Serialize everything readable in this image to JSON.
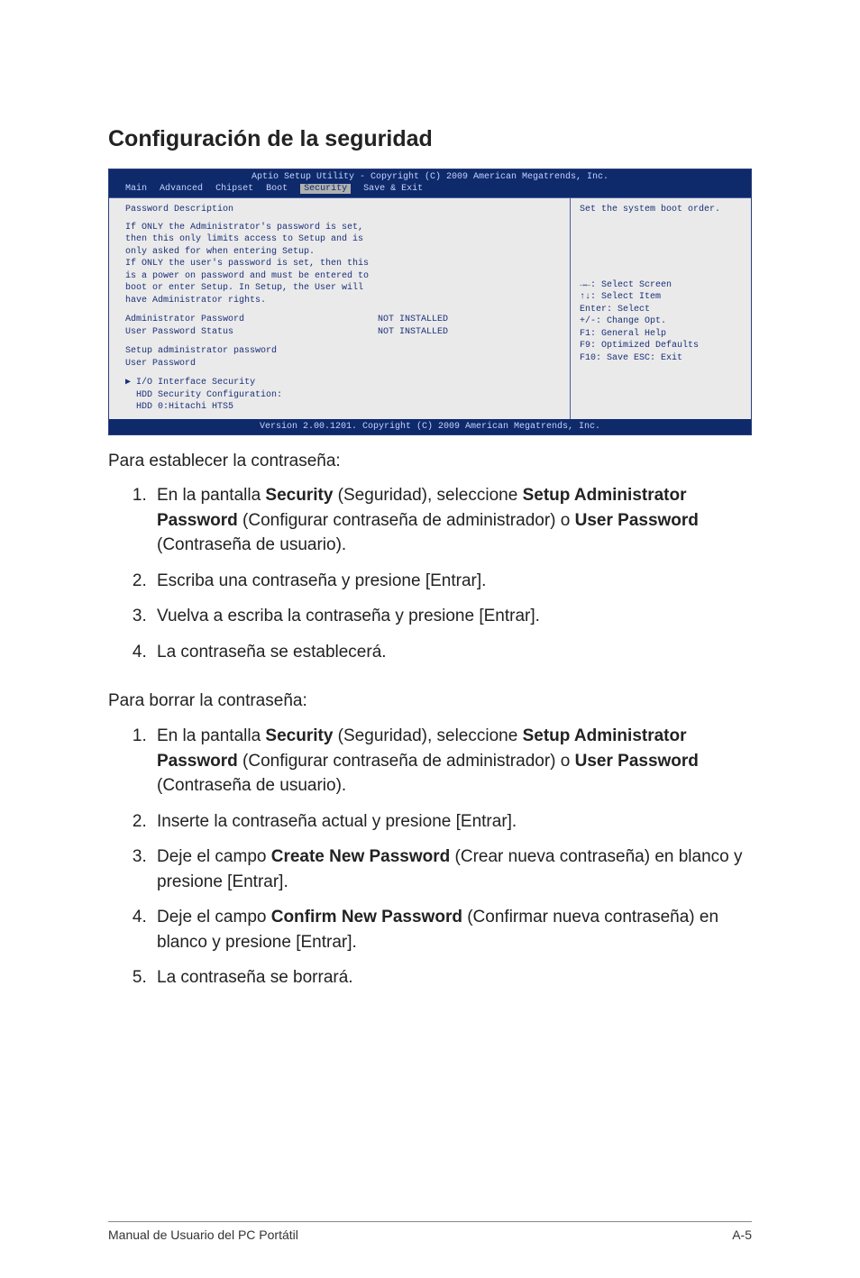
{
  "heading": "Configuración de la seguridad",
  "bios": {
    "title_bar": "Aptio Setup Utility - Copyright (C) 2009 American Megatrends, Inc.",
    "tabs": [
      "Main",
      "Advanced",
      "Chipset",
      "Boot",
      "Security",
      "Save & Exit"
    ],
    "selected_tab": "Security",
    "left": {
      "section_title": "Password Description",
      "desc_lines": [
        "If ONLY the Administrator's password is set,",
        "then this only limits access to Setup and is",
        "only asked for when entering Setup.",
        "If ONLY the user's password is set, then this",
        "is a power on password and must be entered to",
        "boot or enter Setup. In Setup, the User will",
        "have Administrator rights."
      ],
      "rows": [
        {
          "label": "Administrator Password",
          "value": "NOT INSTALLED"
        },
        {
          "label": "User Password Status",
          "value": "NOT INSTALLED"
        }
      ],
      "plain_lines": [
        "Setup administrator password",
        "User Password"
      ],
      "section2_marker": "▶",
      "section2_lines": [
        "I/O Interface Security",
        "HDD Security Configuration:",
        "HDD 0:Hitachi HTS5"
      ]
    },
    "right": {
      "hint": "Set the system boot order.",
      "keys": [
        "→←: Select Screen",
        "↑↓:   Select Item",
        "Enter: Select",
        "+/-:  Change Opt.",
        "F1:   General Help",
        "F9:   Optimized Defaults",
        "F10: Save   ESC: Exit"
      ]
    },
    "footer": "Version 2.00.1201. Copyright (C) 2009 American Megatrends, Inc."
  },
  "set_intro": "Para establecer la contraseña:",
  "set_steps": {
    "s1a": "En la pantalla ",
    "s1b": "Security",
    "s1c": " (Seguridad), seleccione ",
    "s1d": "Setup Administrator Password",
    "s1e": " (Configurar contraseña de administrador) o ",
    "s1f": "User Password",
    "s1g": " (Contraseña de usuario).",
    "s2": "Escriba una contraseña y presione [Entrar].",
    "s3": "Vuelva a escriba la contraseña y presione [Entrar].",
    "s4": "La contraseña se establecerá."
  },
  "clear_intro": "Para borrar la contraseña:",
  "clear_steps": {
    "c1a": "En la pantalla ",
    "c1b": "Security",
    "c1c": " (Seguridad), seleccione ",
    "c1d": "Setup Administrator Password",
    "c1e": " (Configurar contraseña de administrador) o ",
    "c1f": "User Password",
    "c1g": " (Contraseña de usuario).",
    "c2": "Inserte la contraseña actual y presione [Entrar].",
    "c3a": "Deje el campo ",
    "c3b": "Create New Password",
    "c3c": " (Crear nueva contraseña) en blanco y presione [Entrar].",
    "c4a": "Deje el campo ",
    "c4b": "Confirm New Password",
    "c4c": " (Confirmar nueva contraseña) en blanco y presione [Entrar].",
    "c5": "La contraseña se borrará."
  },
  "footer_left": "Manual de Usuario del PC Portátil",
  "footer_right": "A-5"
}
